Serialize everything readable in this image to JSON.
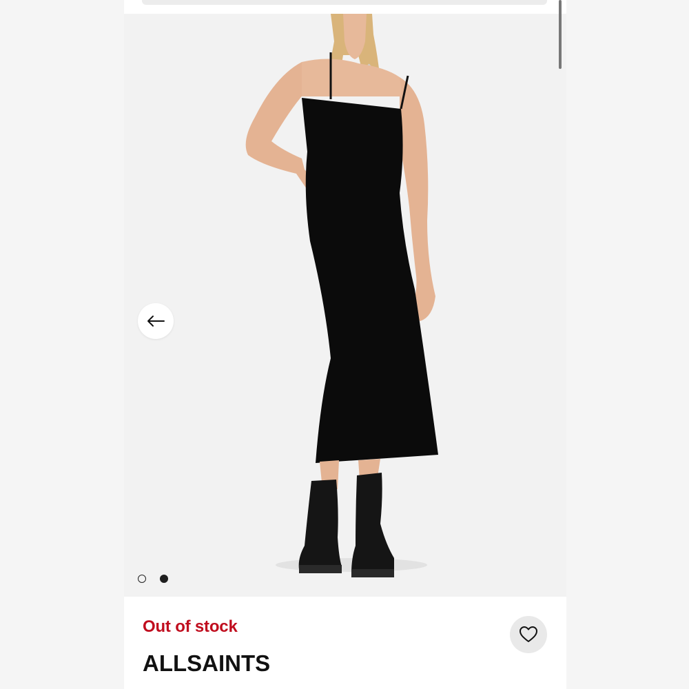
{
  "product": {
    "stock_status": "Out of stock",
    "brand": "ALLSAINTS"
  },
  "gallery": {
    "image_count": 2,
    "active_index": 1
  },
  "icons": {
    "prev": "arrow-left-icon",
    "favorite": "heart-icon"
  },
  "colors": {
    "stock_status": "#c00d1e",
    "dress": "#0b0b0b"
  }
}
